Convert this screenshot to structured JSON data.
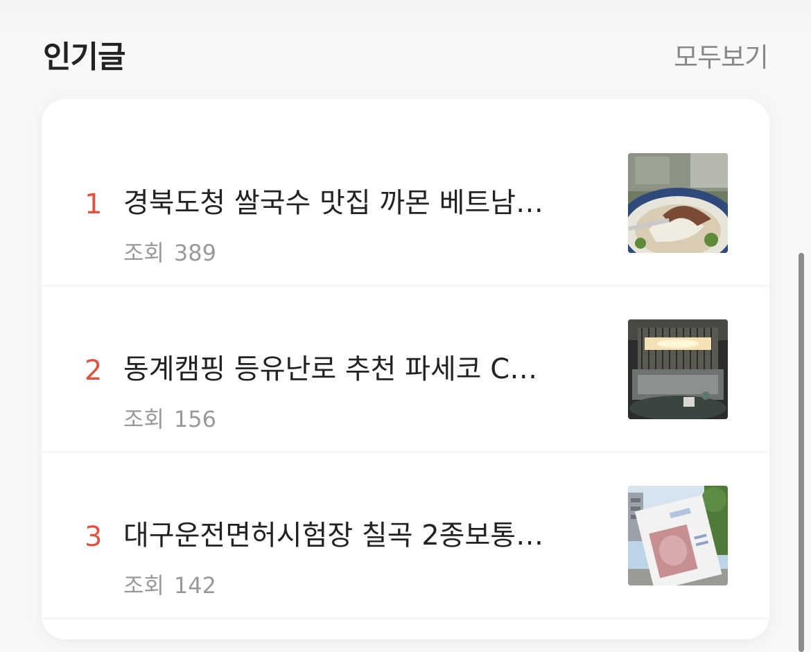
{
  "header": {
    "title": "인기글",
    "view_all": "모두보기"
  },
  "posts": [
    {
      "rank": "1",
      "title": "경북도청 쌀국수 맛집 까몬 베트남…",
      "views_label": "조회",
      "views": "389",
      "thumb_icon": "pho-noodle-photo"
    },
    {
      "rank": "2",
      "title": "동계캠핑 등유난로 추천 파세코 C…",
      "views_label": "조회",
      "views": "156",
      "thumb_icon": "kerosene-heater-photo"
    },
    {
      "rank": "3",
      "title": "대구운전면허시험장 칠곡 2종보통…",
      "views_label": "조회",
      "views": "142",
      "thumb_icon": "license-card-photo"
    }
  ],
  "colors": {
    "rank": "#e0523d",
    "title": "#222222",
    "meta": "#999999"
  }
}
